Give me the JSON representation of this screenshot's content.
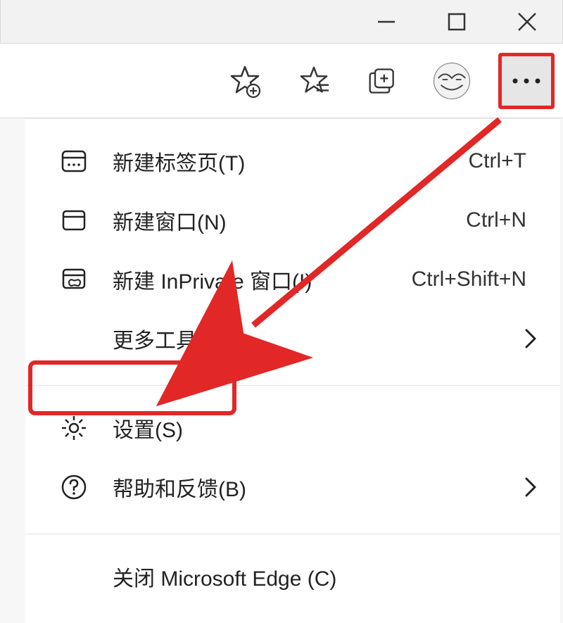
{
  "titlebar": {
    "minimize": "minimize",
    "maximize": "maximize",
    "close": "close"
  },
  "toolbar": {
    "add_favorite": "add-favorite",
    "favorites": "favorites",
    "collections": "collections",
    "profile": "profile",
    "more": "more"
  },
  "menu": {
    "section1": [
      {
        "id": "new-tab",
        "label": "新建标签页(T)",
        "shortcut": "Ctrl+T",
        "icon": "new-tab-icon",
        "has_chevron": false
      },
      {
        "id": "new-window",
        "label": "新建窗口(N)",
        "shortcut": "Ctrl+N",
        "icon": "new-window-icon",
        "has_chevron": false
      },
      {
        "id": "new-inprivate",
        "label": "新建 InPrivate 窗口(I)",
        "shortcut": "Ctrl+Shift+N",
        "icon": "inprivate-icon",
        "has_chevron": false
      },
      {
        "id": "more-tools",
        "label": "更多工具(L)",
        "shortcut": "",
        "icon": "",
        "has_chevron": true
      }
    ],
    "section2": [
      {
        "id": "settings",
        "label": "设置(S)",
        "shortcut": "",
        "icon": "gear-icon",
        "has_chevron": false
      },
      {
        "id": "help",
        "label": "帮助和反馈(B)",
        "shortcut": "",
        "icon": "help-icon",
        "has_chevron": true
      }
    ],
    "section3": [
      {
        "id": "close-edge",
        "label": "关闭 Microsoft Edge (C)",
        "shortcut": "",
        "icon": "",
        "has_chevron": false
      }
    ]
  },
  "annotation": {
    "highlight_more_button": true,
    "highlight_settings_item": true,
    "arrow_from_more_to_settings": true
  }
}
